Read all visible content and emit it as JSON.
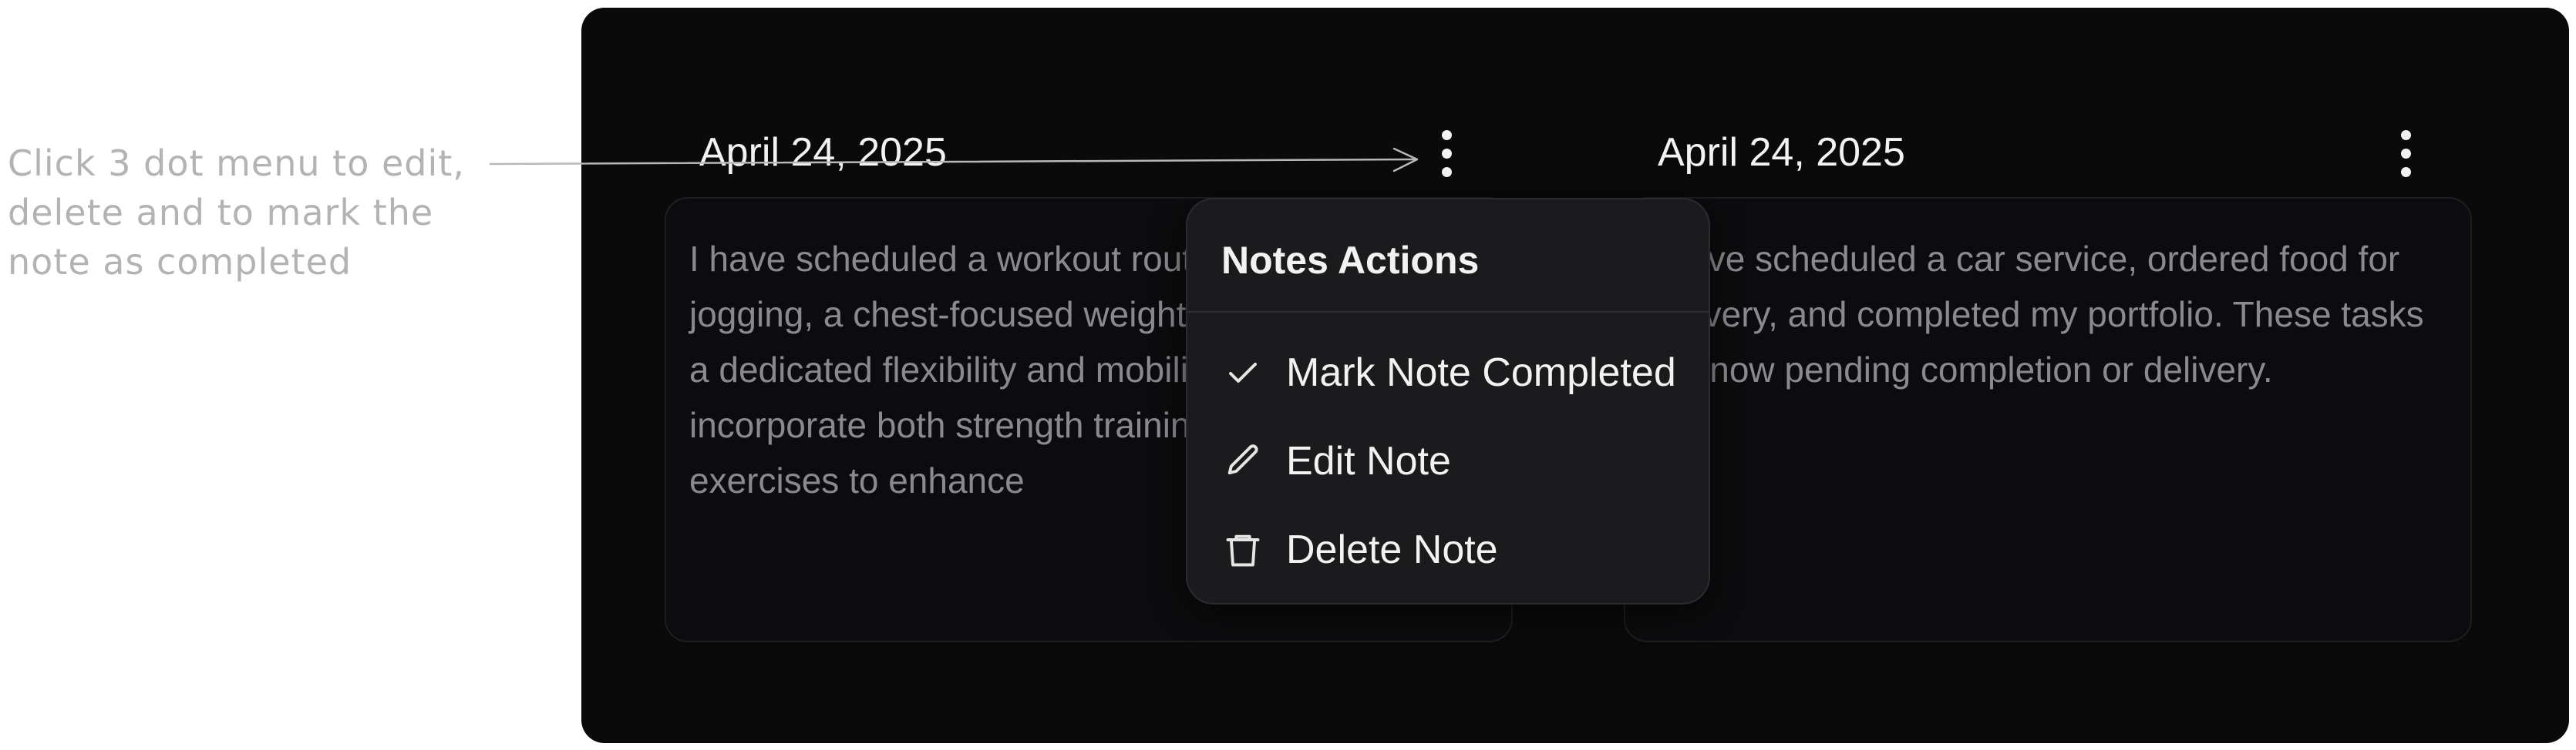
{
  "annotation": {
    "lines": [
      "Click 3 dot menu to edit,",
      "delete and to mark the",
      "note as completed"
    ]
  },
  "notes": [
    {
      "date": "April 24, 2025",
      "text": "I have scheduled a workout routine that includes jogging, a chest-focused weightlifting session, and a dedicated flexibility and mobility session. These incorporate both strength training and mobility exercises to enhance"
    },
    {
      "date": "April 24, 2025",
      "text": "I have scheduled a car service, ordered food for delivery, and completed my portfolio. These tasks are now pending completion or delivery."
    }
  ],
  "menu": {
    "title": "Notes Actions",
    "items": [
      {
        "label": "Mark Note Completed",
        "icon": "check-icon"
      },
      {
        "label": "Edit Note",
        "icon": "pencil-icon"
      },
      {
        "label": "Delete Note",
        "icon": "trash-icon"
      }
    ]
  },
  "colors": {
    "panel_bg": "#0a0a0b",
    "menu_bg": "#1b1b1e",
    "text_primary": "#f2f2f2",
    "text_muted": "#8a8a8e",
    "annotation": "#b3b3b3"
  }
}
